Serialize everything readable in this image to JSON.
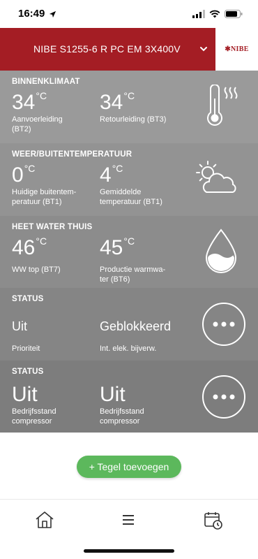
{
  "status_bar": {
    "time": "16:49"
  },
  "header": {
    "device_title": "NIBE S1255-6 R PC EM 3X400V",
    "logo_text": "NIBE"
  },
  "tiles": [
    {
      "label": "BINNENKLIMAAT",
      "items": [
        {
          "value": "34",
          "unit": "°C",
          "desc_line1": "Aanvoerleiding",
          "desc_line2": "(BT2)"
        },
        {
          "value": "34",
          "unit": "°C",
          "desc_line1": "Retourleiding (BT3)",
          "desc_line2": ""
        }
      ],
      "icon": "thermometer-heat-icon"
    },
    {
      "label": "WEER/BUITENTEMPERATUUR",
      "items": [
        {
          "value": "0",
          "unit": "°C",
          "desc_line1": "Huidige buitentem-",
          "desc_line2": "peratuur (BT1)"
        },
        {
          "value": "4",
          "unit": "°C",
          "desc_line1": "Gemiddelde",
          "desc_line2": "temperatuur (BT1)"
        }
      ],
      "icon": "sun-cloud-icon"
    },
    {
      "label": "HEET WATER THUIS",
      "items": [
        {
          "value": "46",
          "unit": "°C",
          "desc_line1": "WW top (BT7)",
          "desc_line2": ""
        },
        {
          "value": "45",
          "unit": "°C",
          "desc_line1": "Productie warmwa-",
          "desc_line2": "ter (BT6)"
        }
      ],
      "icon": "water-drop-icon"
    },
    {
      "label": "STATUS",
      "items": [
        {
          "value": "Uit",
          "desc_line1": "Prioriteit"
        },
        {
          "value": "Geblokkeerd",
          "desc_line1": "Int. elek. bijverw."
        }
      ],
      "icon": "more-icon"
    },
    {
      "label": "STATUS",
      "items": [
        {
          "value": "Uit",
          "desc_line1": "Bedrijfsstand",
          "desc_line2": "compressor"
        },
        {
          "value": "Uit",
          "desc_line1": "Bedrijfsstand",
          "desc_line2": "compressor"
        }
      ],
      "icon": "more-icon"
    }
  ],
  "add_tile_button": {
    "label": "+ Tegel toevoegen",
    "color": "#5cb85c"
  },
  "bottom_nav": {
    "items": [
      "home-icon",
      "menu-icon",
      "calendar-clock-icon"
    ]
  },
  "colors": {
    "header_red": "#a41d24",
    "tile_gray": "#9a9a9a"
  }
}
